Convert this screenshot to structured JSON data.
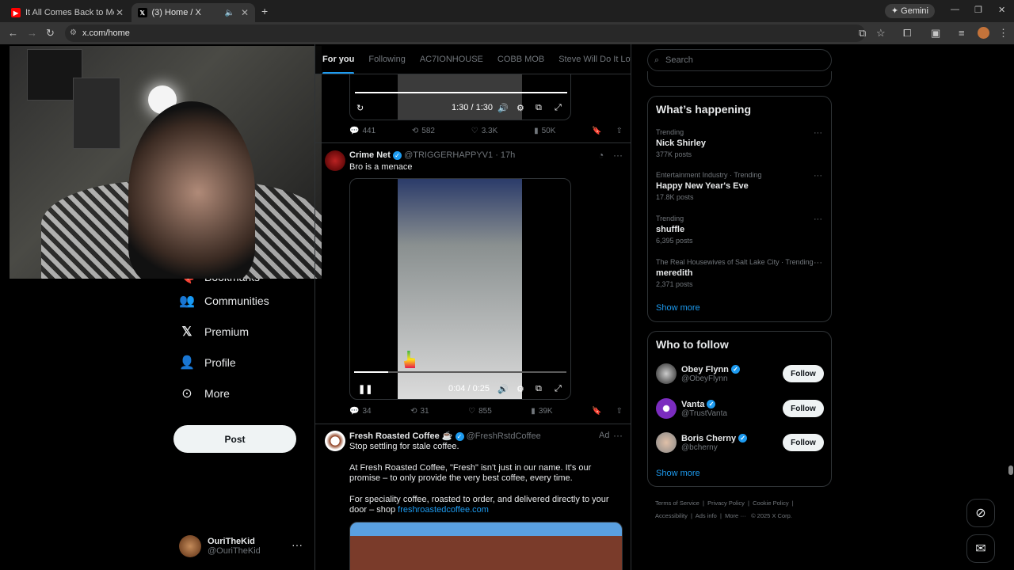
{
  "browser": {
    "tabs": [
      {
        "title": "It All Comes Back to Me - Baby",
        "active": false
      },
      {
        "title": "(3) Home / X",
        "active": true
      }
    ],
    "url": "x.com/home",
    "gemini_label": "Gemini"
  },
  "left_nav": {
    "items": [
      {
        "label": "Bookmarks",
        "icon": "bookmark-icon"
      },
      {
        "label": "Communities",
        "icon": "communities-icon"
      },
      {
        "label": "Premium",
        "icon": "x-logo-icon"
      },
      {
        "label": "Profile",
        "icon": "profile-icon"
      },
      {
        "label": "More",
        "icon": "more-circle-icon"
      }
    ],
    "post_label": "Post",
    "account": {
      "name": "OuriTheKid",
      "handle": "@OuriTheKid"
    }
  },
  "feed": {
    "tabs": [
      "For you",
      "Following",
      "AC7IONHOUSE",
      "COBB MOB",
      "Steve Will Do It Loyal"
    ],
    "selected_tab": "For you",
    "tweet1": {
      "video_time": "1:30 / 1:30",
      "progress": 1.0,
      "stats": {
        "replies": "441",
        "reposts": "582",
        "likes": "3.3K",
        "views": "50K"
      }
    },
    "tweet2": {
      "name": "Crime Net",
      "handle": "@TRIGGERHAPPYV1",
      "time": "· 17h",
      "text": "Bro is a menace",
      "video_time": "0:04 / 0:25",
      "progress": 0.16,
      "stats": {
        "replies": "34",
        "reposts": "31",
        "likes": "855",
        "views": "39K"
      }
    },
    "tweet3": {
      "name": "Fresh Roasted Coffee ☕",
      "handle": "@FreshRstdCoffee",
      "ad_label": "Ad",
      "line1": "Stop settling for stale coffee.",
      "line2": "At Fresh Roasted Coffee, \"Fresh\" isn't just in our name. It's our promise – to only provide the very best coffee, every time.",
      "line3": "For speciality coffee, roasted to order,  and delivered directly to your door – shop",
      "link": "freshroastedcoffee.com"
    }
  },
  "sidebar": {
    "search_placeholder": "Search",
    "whats_happening": {
      "title": "What’s happening",
      "trends": [
        {
          "context": "Trending",
          "topic": "Nick Shirley",
          "posts": "377K posts"
        },
        {
          "context": "Entertainment Industry · Trending",
          "topic": "Happy New Year's Eve",
          "posts": "17.8K posts"
        },
        {
          "context": "Trending",
          "topic": "shuffle",
          "posts": "6,395 posts"
        },
        {
          "context": "The Real Housewives of Salt Lake City · Trending",
          "topic": "meredith",
          "posts": "2,371 posts"
        }
      ],
      "show_more": "Show more"
    },
    "who_to_follow": {
      "title": "Who to follow",
      "users": [
        {
          "name": "Obey Flynn",
          "handle": "@ObeyFlynn",
          "button": "Follow"
        },
        {
          "name": "Vanta",
          "handle": "@TrustVanta",
          "button": "Follow"
        },
        {
          "name": "Boris Cherny",
          "handle": "@bcherny",
          "button": "Follow"
        }
      ],
      "show_more": "Show more"
    },
    "footer": [
      "Terms of Service",
      "Privacy Policy",
      "Cookie Policy",
      "Accessibility",
      "Ads info",
      "More ···",
      "© 2025 X Corp."
    ]
  },
  "colors": {
    "accent": "#1d9bf0",
    "background": "#000000",
    "text": "#e7e9ea",
    "muted": "#71767b"
  }
}
